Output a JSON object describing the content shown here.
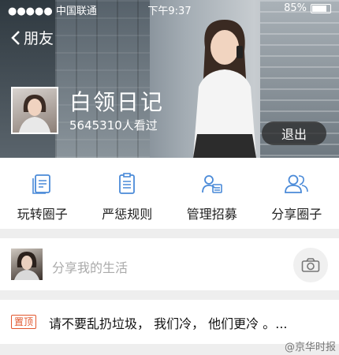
{
  "status_bar": {
    "carrier": "●●●●● 中国联通",
    "time": "下午9:37",
    "battery": "85%"
  },
  "header": {
    "back_label": "朋友",
    "title": "白领日记",
    "views": "5645310人看过",
    "logout_label": "退出"
  },
  "menu": [
    {
      "label": "玩转圈子",
      "icon": "document-icon"
    },
    {
      "label": "严惩规则",
      "icon": "clipboard-icon"
    },
    {
      "label": "管理招募",
      "icon": "recruit-icon"
    },
    {
      "label": "分享圈子",
      "icon": "people-icon"
    }
  ],
  "composer": {
    "placeholder": "分享我的生活"
  },
  "pinned": {
    "tag": "置顶",
    "text": "请不要乱扔垃圾，  我们冷，  他们更冷  。..."
  },
  "watermark": "@京华时报",
  "colors": {
    "icon_blue": "#4a8ad8",
    "pin_red": "#e2572e"
  }
}
